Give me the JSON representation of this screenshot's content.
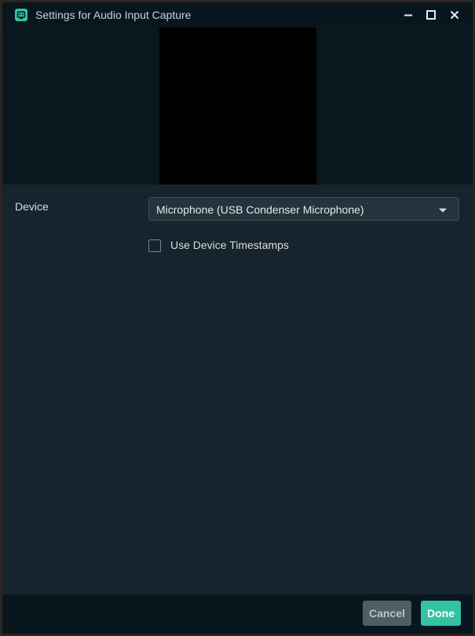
{
  "window": {
    "title": "Settings for Audio Input Capture",
    "app_icon": "streamlabs-robot-icon",
    "controls": {
      "minimize_icon": "minimize-icon",
      "maximize_icon": "maximize-icon",
      "close_icon": "close-icon"
    }
  },
  "preview": {
    "background": "#000000"
  },
  "properties": {
    "device": {
      "label": "Device",
      "selected_value": "Microphone (USB Condenser Microphone)",
      "caret_icon": "chevron-down-icon"
    },
    "use_device_timestamps": {
      "label": "Use Device Timestamps",
      "checked": false
    }
  },
  "footer": {
    "cancel_label": "Cancel",
    "done_label": "Done"
  },
  "colors": {
    "accent": "#31c3a2",
    "panel": "#17242d",
    "titlebar": "#09161d"
  }
}
